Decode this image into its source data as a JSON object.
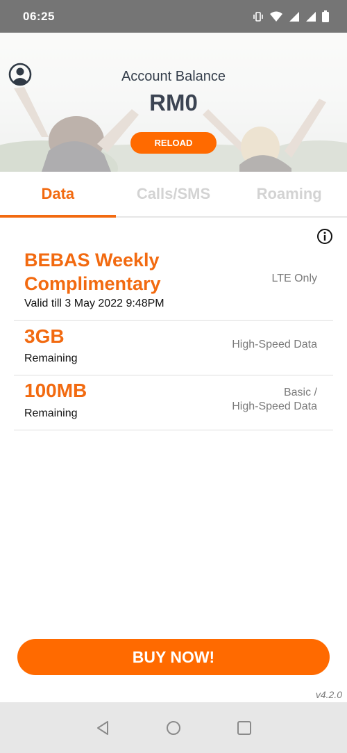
{
  "status_bar": {
    "time": "06:25",
    "icons": [
      "vibrate-icon",
      "wifi-icon",
      "signal-icon",
      "signal-icon",
      "battery-icon"
    ]
  },
  "header": {
    "balance_label": "Account Balance",
    "balance_value": "RM0",
    "reload_label": "RELOAD",
    "profile_icon": "profile-icon"
  },
  "tabs": [
    {
      "label": "Data",
      "active": true
    },
    {
      "label": "Calls/SMS",
      "active": false
    },
    {
      "label": "Roaming",
      "active": false
    }
  ],
  "plan": {
    "title": "BEBAS Weekly Complimentary",
    "tag": "LTE Only",
    "valid": "Valid till 3 May 2022 9:48PM",
    "info_icon": "info-icon",
    "rows": [
      {
        "amount": "3GB",
        "remaining": "Remaining",
        "type": "High-Speed Data"
      },
      {
        "amount": "100MB",
        "remaining": "Remaining",
        "type_line1": "Basic /",
        "type_line2": "High-Speed Data"
      }
    ]
  },
  "buy_label": "BUY NOW!",
  "version": "v4.2.0",
  "nav": [
    "back-icon",
    "home-icon",
    "recents-icon"
  ],
  "colors": {
    "accent": "#FF6A00",
    "tab_active": "#F26A10",
    "tab_inactive": "#D3D3D3"
  }
}
